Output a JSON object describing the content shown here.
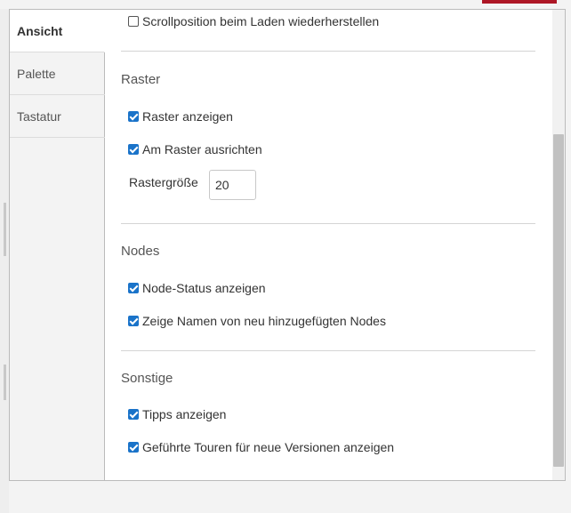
{
  "tabs": [
    {
      "label": "Ansicht",
      "active": true
    },
    {
      "label": "Palette",
      "active": false
    },
    {
      "label": "Tastatur",
      "active": false
    }
  ],
  "settings": {
    "restore_scroll": {
      "label": "Scrollposition beim Laden wiederherstellen",
      "checked": false
    },
    "raster": {
      "title": "Raster",
      "show_grid": {
        "label": "Raster anzeigen",
        "checked": true
      },
      "snap_grid": {
        "label": "Am Raster ausrichten",
        "checked": true
      },
      "grid_size_label": "Rastergröße",
      "grid_size_value": "20"
    },
    "nodes": {
      "title": "Nodes",
      "show_status": {
        "label": "Node-Status anzeigen",
        "checked": true
      },
      "show_names": {
        "label": "Zeige Namen von neu hinzugefügten Nodes",
        "checked": true
      }
    },
    "other": {
      "title": "Sonstige",
      "show_tips": {
        "label": "Tipps anzeigen",
        "checked": true
      },
      "guided_tours": {
        "label": "Geführte Touren für neue Versionen anzeigen",
        "checked": true
      }
    }
  },
  "colors": {
    "accent": "#ad1625",
    "checkbox": "#1a73c9"
  }
}
